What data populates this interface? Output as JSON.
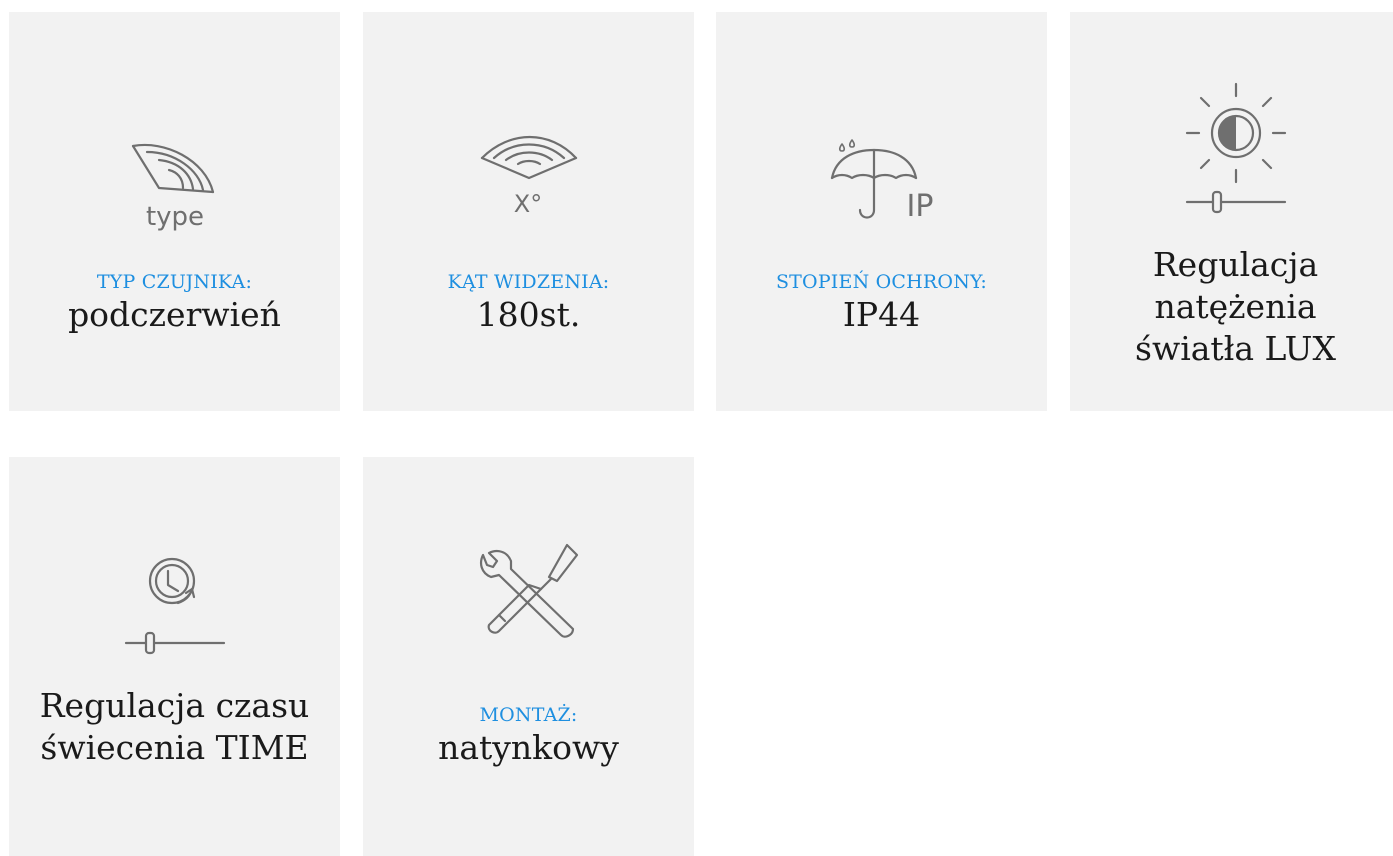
{
  "tiles": [
    {
      "icon": "sensor-type-icon",
      "icon_text": "type",
      "label": "TYP CZUJNIKA:",
      "value": "podczerwień"
    },
    {
      "icon": "viewing-angle-icon",
      "icon_text": "X°",
      "label": "KĄT WIDZENIA:",
      "value": "180st."
    },
    {
      "icon": "umbrella-ip-icon",
      "icon_text": "IP",
      "label": "STOPIEŃ OCHRONY:",
      "value": "IP44"
    },
    {
      "icon": "brightness-slider-icon",
      "lines": [
        "Regulacja",
        "natężenia",
        "światła LUX"
      ]
    },
    {
      "icon": "timer-slider-icon",
      "lines": [
        "Regulacja czasu",
        "świecenia TIME"
      ]
    },
    {
      "icon": "tools-icon",
      "label": "MONTAŻ:",
      "value": "natynkowy"
    }
  ],
  "colors": {
    "tile_background": "#f2f2f2",
    "label": "#1e8fe0",
    "value": "#1a1a1a",
    "icon": "#6f6f6f"
  }
}
